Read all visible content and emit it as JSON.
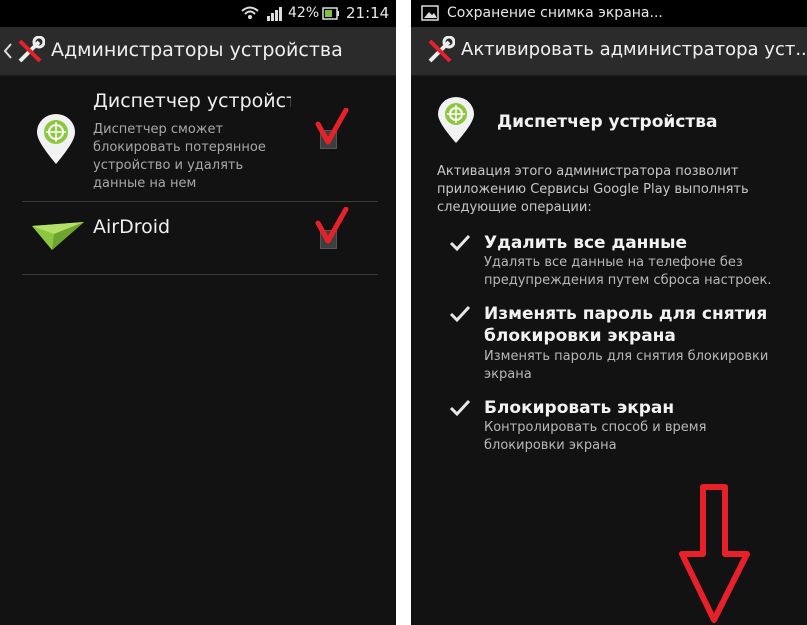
{
  "left": {
    "status": {
      "battery": "42%",
      "time": "21:14"
    },
    "title": "Администраторы устройства",
    "items": [
      {
        "name": "Диспетчер устройства",
        "desc": "Диспетчер сможет блокировать потерянное устройство и удалять данные на нем"
      },
      {
        "name": "AirDroid",
        "desc": ""
      }
    ]
  },
  "right": {
    "status": {
      "notification": "Сохранение снимка экрана..."
    },
    "title": "Активировать администратора уст...",
    "app_name": "Диспетчер устройства",
    "intro": "Активация этого администратора позволит приложению Сервисы Google Play выполнять следующие операции:",
    "permissions": [
      {
        "title": "Удалить все данные",
        "desc": "Удалять все данные на телефоне без предупреждения путем сброса настроек."
      },
      {
        "title": "Изменять пароль для снятия блокировки экрана",
        "desc": "Изменять пароль для снятия блокировки экрана"
      },
      {
        "title": "Блокировать экран",
        "desc": "Контролировать способ и время блокировки экрана"
      }
    ]
  },
  "colors": {
    "screen_bg": "#121212",
    "action_bar": "#2b2b2b",
    "annotation_red": "#e8202a",
    "app_green": "#8dc63f"
  }
}
